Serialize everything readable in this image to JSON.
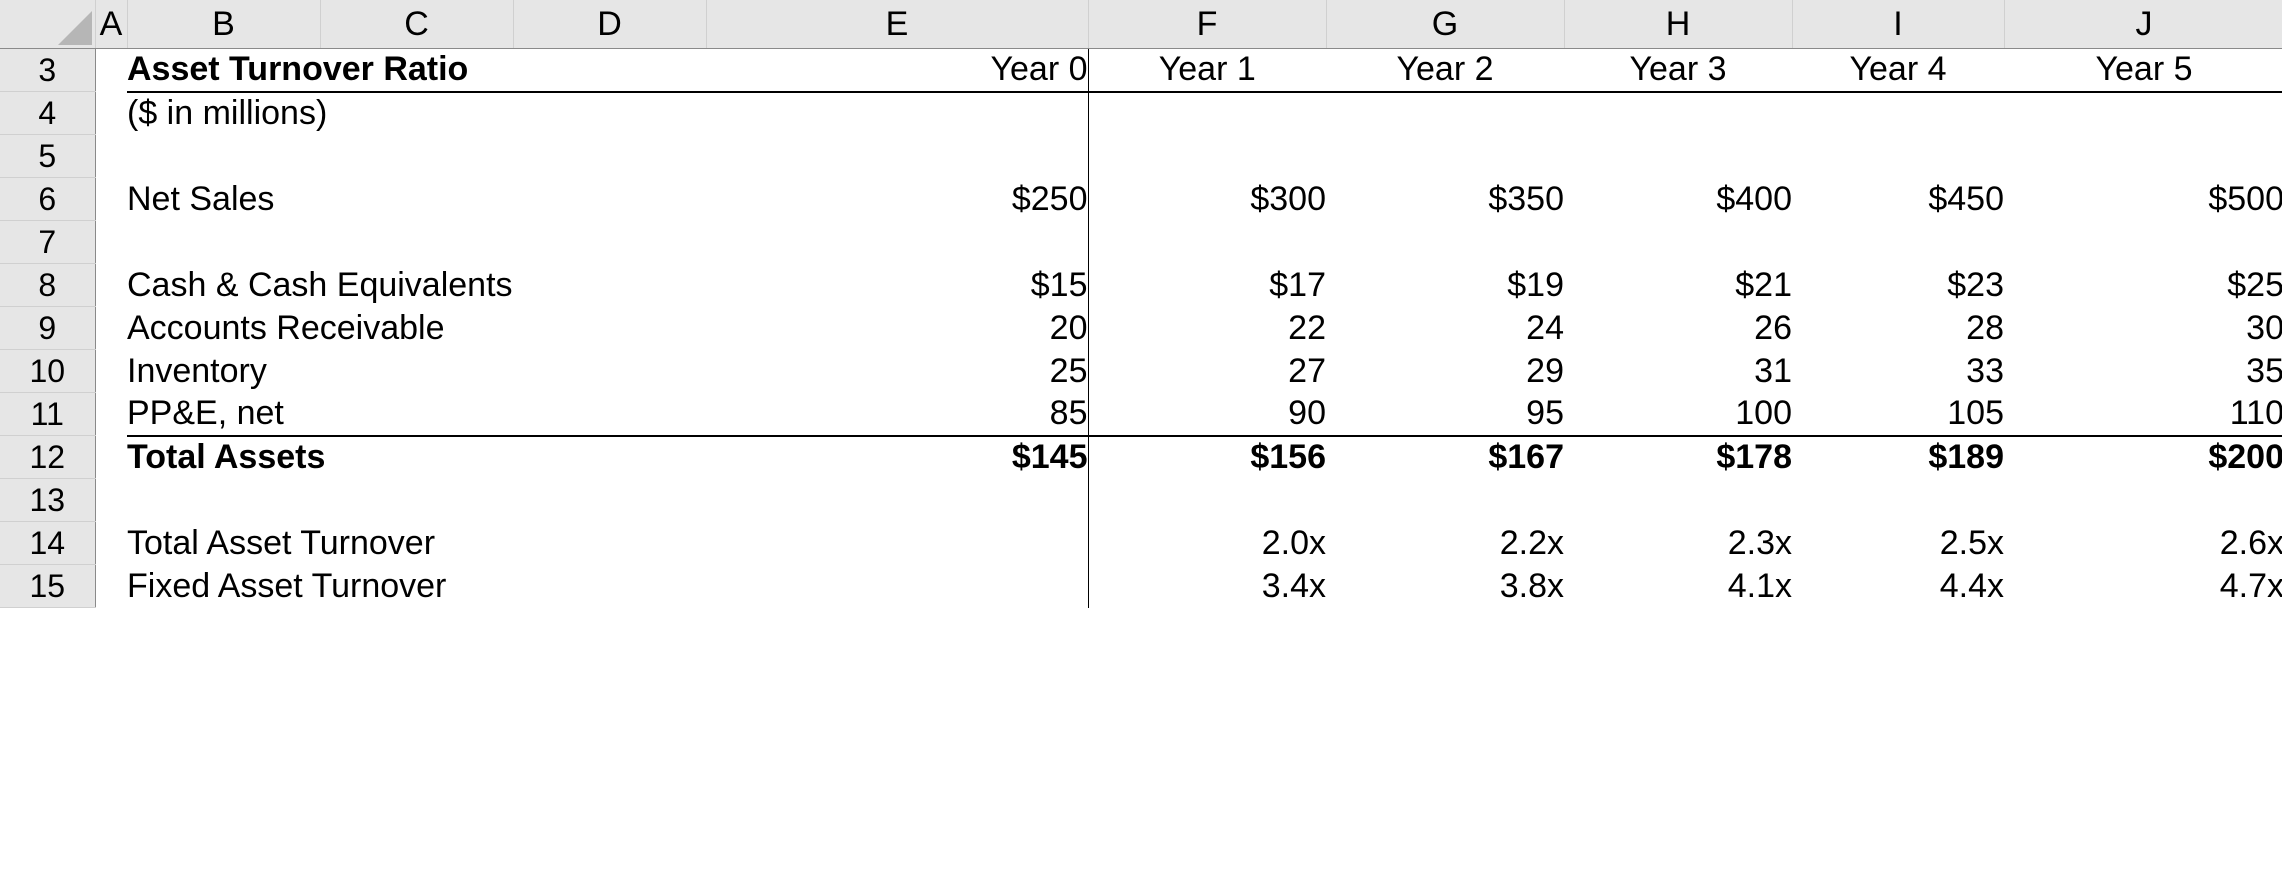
{
  "spreadsheet": {
    "column_headers": [
      "A",
      "B",
      "C",
      "D",
      "E",
      "F",
      "G",
      "H",
      "I",
      "J"
    ],
    "row_numbers": [
      "3",
      "4",
      "5",
      "6",
      "7",
      "8",
      "9",
      "10",
      "11",
      "12",
      "13",
      "14",
      "15"
    ],
    "colors": {
      "input_blue": "#0000FF",
      "formula_black": "#000000",
      "header_gray": "#E6E6E6",
      "gridline": "#D0D0D0"
    }
  },
  "title": "Asset Turnover Ratio",
  "units_note": "($ in millions)",
  "period_headers": {
    "year0": "Year 0",
    "forecast": [
      "Year 1",
      "Year 2",
      "Year 3",
      "Year 4",
      "Year 5"
    ]
  },
  "chart_data": {
    "type": "table",
    "title": "Asset Turnover Ratio",
    "subtitle": "($ in millions)",
    "categories": [
      "Year 0",
      "Year 1",
      "Year 2",
      "Year 3",
      "Year 4",
      "Year 5"
    ],
    "series": [
      {
        "name": "Net Sales",
        "values": [
          "$250",
          "$300",
          "$350",
          "$400",
          "$450",
          "$500"
        ]
      },
      {
        "name": "Cash & Cash Equivalents",
        "values": [
          "$15",
          "$17",
          "$19",
          "$21",
          "$23",
          "$25"
        ]
      },
      {
        "name": "Accounts Receivable",
        "values": [
          "20",
          "22",
          "24",
          "26",
          "28",
          "30"
        ]
      },
      {
        "name": "Inventory",
        "values": [
          "25",
          "27",
          "29",
          "31",
          "33",
          "35"
        ]
      },
      {
        "name": "PP&E, net",
        "values": [
          "85",
          "90",
          "95",
          "100",
          "105",
          "110"
        ]
      },
      {
        "name": "Total Assets",
        "values": [
          "$145",
          "$156",
          "$167",
          "$178",
          "$189",
          "$200"
        ]
      },
      {
        "name": "Total Asset Turnover",
        "values": [
          "",
          "2.0x",
          "2.2x",
          "2.3x",
          "2.5x",
          "2.6x"
        ]
      },
      {
        "name": "Fixed Asset Turnover",
        "values": [
          "",
          "3.4x",
          "3.8x",
          "4.1x",
          "4.4x",
          "4.7x"
        ]
      }
    ]
  },
  "rows": {
    "r3": {
      "label": "Asset Turnover Ratio",
      "e": "Year 0",
      "f": "Year 1",
      "g": "Year 2",
      "h": "Year 3",
      "i": "Year 4",
      "j": "Year 5"
    },
    "r4": {
      "label": "($ in millions)",
      "e": "",
      "f": "",
      "g": "",
      "h": "",
      "i": "",
      "j": ""
    },
    "r5": {
      "label": "",
      "e": "",
      "f": "",
      "g": "",
      "h": "",
      "i": "",
      "j": ""
    },
    "r6": {
      "label": "Net Sales",
      "e": "$250",
      "f": "$300",
      "g": "$350",
      "h": "$400",
      "i": "$450",
      "j": "$500"
    },
    "r7": {
      "label": "",
      "e": "",
      "f": "",
      "g": "",
      "h": "",
      "i": "",
      "j": ""
    },
    "r8": {
      "label": "Cash & Cash Equivalents",
      "e": "$15",
      "f": "$17",
      "g": "$19",
      "h": "$21",
      "i": "$23",
      "j": "$25"
    },
    "r9": {
      "label": "Accounts Receivable",
      "e": "20",
      "f": "22",
      "g": "24",
      "h": "26",
      "i": "28",
      "j": "30"
    },
    "r10": {
      "label": "Inventory",
      "e": "25",
      "f": "27",
      "g": "29",
      "h": "31",
      "i": "33",
      "j": "35"
    },
    "r11": {
      "label": "PP&E, net",
      "e": "85",
      "f": "90",
      "g": "95",
      "h": "100",
      "i": "105",
      "j": "110"
    },
    "r12": {
      "label": "Total Assets",
      "e": "$145",
      "f": "$156",
      "g": "$167",
      "h": "$178",
      "i": "$189",
      "j": "$200"
    },
    "r13": {
      "label": "",
      "e": "",
      "f": "",
      "g": "",
      "h": "",
      "i": "",
      "j": ""
    },
    "r14": {
      "label": "Total Asset Turnover",
      "e": "",
      "f": "2.0x",
      "g": "2.2x",
      "h": "2.3x",
      "i": "2.5x",
      "j": "2.6x"
    },
    "r15": {
      "label": "Fixed Asset Turnover",
      "e": "",
      "f": "3.4x",
      "g": "3.8x",
      "h": "4.1x",
      "i": "4.4x",
      "j": "4.7x"
    }
  }
}
